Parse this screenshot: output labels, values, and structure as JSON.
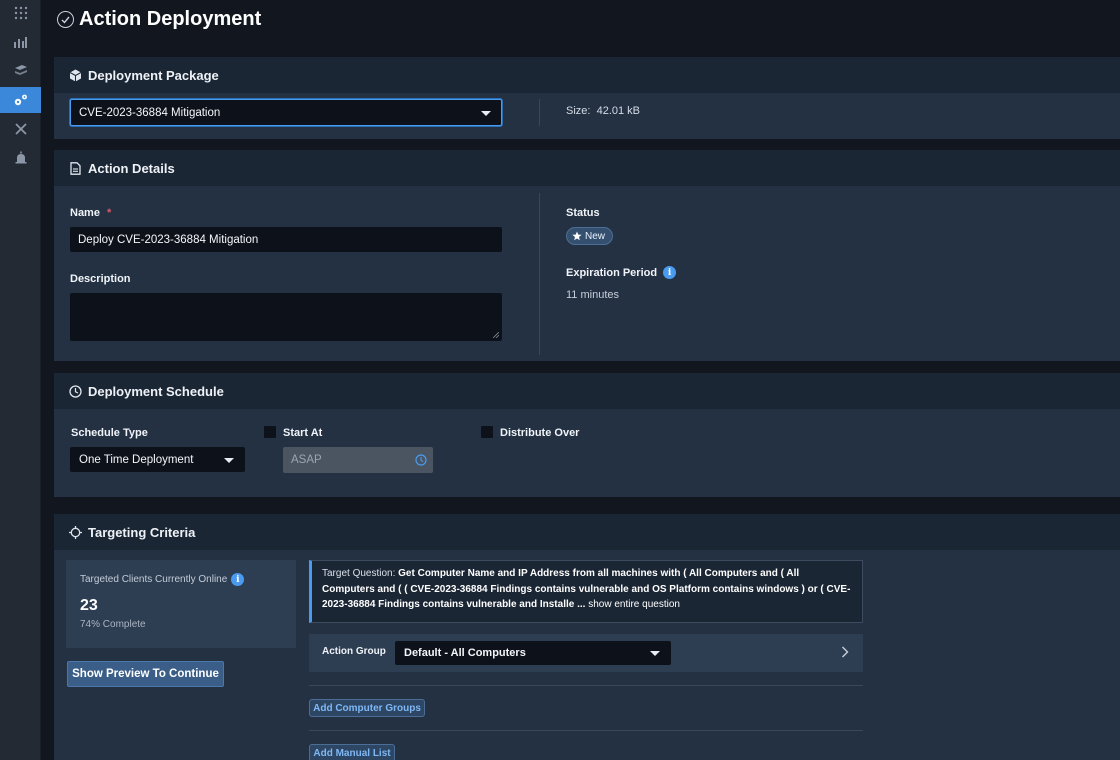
{
  "page": {
    "title": "Action Deployment"
  },
  "rail": {
    "items": [
      {
        "icon": "apps-grid-icon"
      },
      {
        "icon": "reports-icon"
      },
      {
        "icon": "layers-icon"
      },
      {
        "icon": "deploy-gears-icon",
        "active": true
      },
      {
        "icon": "tools-icon"
      },
      {
        "icon": "alerts-icon"
      }
    ]
  },
  "package": {
    "heading": "Deployment Package",
    "selected": "CVE-2023-36884 Mitigation",
    "size_label": "Size:",
    "size_value": "42.01 kB"
  },
  "details": {
    "heading": "Action Details",
    "name_label": "Name",
    "required_mark": "*",
    "name_value": "Deploy CVE-2023-36884 Mitigation",
    "description_label": "Description",
    "description_value": "",
    "status_label": "Status",
    "status_value": "New",
    "expiration_label": "Expiration Period",
    "expiration_value": "11 minutes"
  },
  "schedule": {
    "heading": "Deployment Schedule",
    "type_label": "Schedule Type",
    "type_value": "One Time Deployment",
    "start_at_label": "Start At",
    "start_at_value": "ASAP",
    "distribute_label": "Distribute Over"
  },
  "targeting": {
    "heading": "Targeting Criteria",
    "online_label": "Targeted Clients Currently Online",
    "online_count": "23",
    "complete_text": "74% Complete",
    "preview_button": "Show Preview To Continue",
    "question_prefix": "Target Question:",
    "question_text": "Get Computer Name and IP Address from all machines with ( All Computers and ( All Computers and ( ( CVE-2023-36884 Findings contains vulnerable and OS Platform contains windows ) or ( CVE-2023-36884 Findings contains vulnerable and Installe ...",
    "show_entire": "show entire question",
    "action_group_label": "Action Group",
    "action_group_value": "Default - All Computers",
    "add_groups_button": "Add Computer Groups",
    "add_manual_button": "Add Manual List"
  },
  "colors": {
    "accent": "#4a9bef",
    "panel": "#233143",
    "panel_header": "#1b2634",
    "background": "#11161f"
  }
}
